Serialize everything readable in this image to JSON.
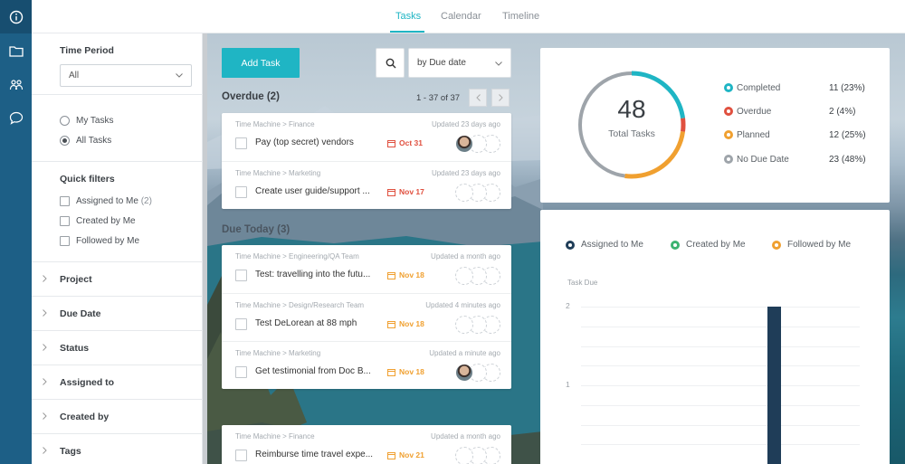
{
  "top_tabs": [
    "Tasks",
    "Calendar",
    "Timeline"
  ],
  "filters": {
    "time_period_label": "Time Period",
    "time_period_value": "All",
    "radio_my_tasks": "My Tasks",
    "radio_all_tasks": "All Tasks",
    "quick_filters_label": "Quick filters",
    "quick_filters": [
      {
        "label": "Assigned to Me",
        "count": "(2)"
      },
      {
        "label": "Created by Me",
        "count": ""
      },
      {
        "label": "Followed by Me",
        "count": ""
      }
    ],
    "accordions": [
      "Project",
      "Due Date",
      "Status",
      "Assigned to",
      "Created by",
      "Tags"
    ]
  },
  "toolbar": {
    "add_task_label": "Add Task",
    "sort_value": "by Due date"
  },
  "overdue": {
    "title": "Overdue (2)",
    "count_text": "1 - 37 of 37",
    "tasks": [
      {
        "crumb": "Time Machine > Finance",
        "updated": "Updated 23 days ago",
        "name": "Pay (top secret) vendors",
        "date": "Oct 31"
      },
      {
        "crumb": "Time Machine > Marketing",
        "updated": "Updated 23 days ago",
        "name": "Create user guide/support ...",
        "date": "Nov 17"
      }
    ]
  },
  "due_today": {
    "title": "Due Today (3)",
    "tasks": [
      {
        "crumb": "Time Machine > Engineering/QA Team",
        "updated": "Updated a month ago",
        "name": "Test: travelling into the futu...",
        "date": "Nov 18"
      },
      {
        "crumb": "Time Machine > Design/Research Team",
        "updated": "Updated 4 minutes ago",
        "name": "Test DeLorean at 88 mph",
        "date": "Nov 18"
      },
      {
        "crumb": "Time Machine > Marketing",
        "updated": "Updated a minute ago",
        "name": "Get testimonial from Doc B...",
        "date": "Nov 18"
      }
    ]
  },
  "upcoming": {
    "tasks": [
      {
        "crumb": "Time Machine > Finance",
        "updated": "Updated a month ago",
        "name": "Reimburse time travel expe...",
        "date": "Nov 21"
      }
    ]
  },
  "colors": {
    "accent": "#1fb5c4",
    "overdue_date": "#e0503f",
    "due_date": "#f0a030",
    "completed": "#1fb5c4",
    "overdue": "#e0503f",
    "planned": "#f0a030",
    "no_due": "#9ea4aa",
    "chart_bar": "#1f3d58"
  },
  "stats": {
    "total": "48",
    "total_label": "Total Tasks",
    "legend": [
      {
        "name": "Completed",
        "value": "11 (23%)",
        "count": 11
      },
      {
        "name": "Overdue",
        "value": "2 (4%)",
        "count": 2
      },
      {
        "name": "Planned",
        "value": "12 (25%)",
        "count": 12
      },
      {
        "name": "No Due Date",
        "value": "23 (48%)",
        "count": 23
      }
    ]
  },
  "chart_data": {
    "type": "bar",
    "title": "",
    "ylabel": "Task Due",
    "series_legend": [
      "Assigned to Me",
      "Created by Me",
      "Followed by Me"
    ],
    "legend_colors": [
      "#1f3d58",
      "#3cb371",
      "#f0a030"
    ],
    "yticks": [
      "2",
      "1"
    ],
    "ylim": [
      0,
      2.2
    ],
    "bars": [
      {
        "series": "Assigned to Me",
        "value": 2
      }
    ],
    "grid": true
  },
  "icons": [
    "info-icon",
    "folder-icon",
    "team-icon",
    "chat-icon",
    "search-icon",
    "chevron-down-icon",
    "calendar-icon"
  ]
}
